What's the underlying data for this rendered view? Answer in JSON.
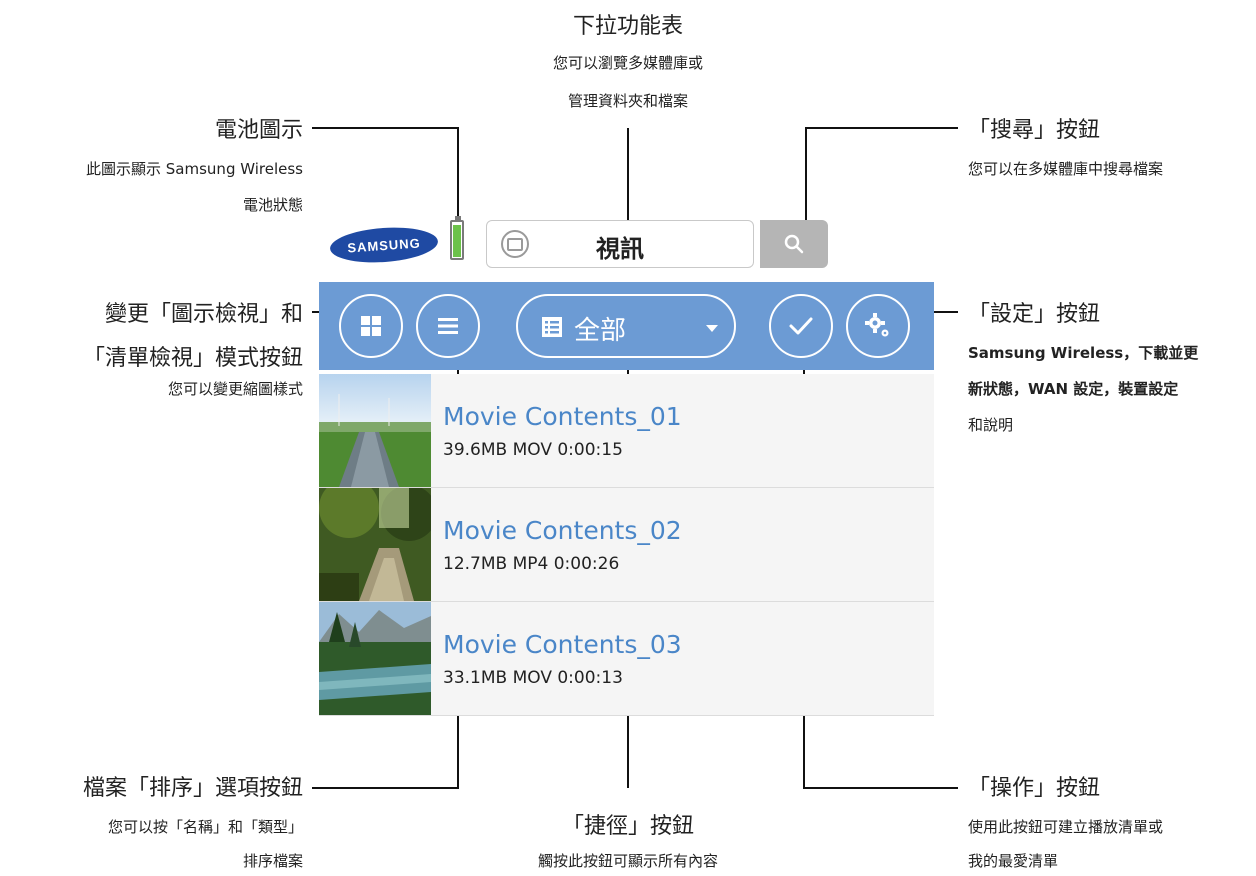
{
  "annotations": {
    "dropdown": {
      "title": "下拉功能表",
      "desc1": "您可以瀏覽多媒體庫或",
      "desc2": "管理資料夾和檔案"
    },
    "battery": {
      "title": "電池圖示",
      "desc1": "此圖示顯示 Samsung Wireless",
      "desc2": "電池狀態"
    },
    "search": {
      "title": "「搜尋」按鈕",
      "desc1": "您可以在多媒體庫中搜尋檔案"
    },
    "view_mode": {
      "title1": "變更「圖示檢視」和",
      "title2": "「清單檢視」模式按鈕",
      "desc1": "您可以變更縮圖樣式"
    },
    "settings": {
      "title": "「設定」按鈕",
      "desc1": "Samsung Wireless，下載並更",
      "desc2": "新狀態，WAN 設定，裝置設定",
      "desc3": "和說明"
    },
    "sort": {
      "title": "檔案「排序」選項按鈕",
      "desc1": "您可以按「名稱」和「類型」",
      "desc2": "排序檔案"
    },
    "shortcut": {
      "title": "「捷徑」按鈕",
      "desc1": "觸按此按鈕可顯示所有內容"
    },
    "action": {
      "title": "「操作」按鈕",
      "desc1": "使用此按鈕可建立播放清單或",
      "desc2": "我的最愛清單"
    }
  },
  "app": {
    "logo_text": "SAMSUNG",
    "dropdown_label": "視訊",
    "shortcut_label": "全部",
    "colors": {
      "toolbar": "#6c9bd4",
      "title_text": "#4a86c8",
      "battery": "#6cc24a"
    }
  },
  "files": [
    {
      "name": "Movie Contents_01",
      "meta": "39.6MB  MOV  0:00:15"
    },
    {
      "name": "Movie Contents_02",
      "meta": "12.7MB  MP4  0:00:26"
    },
    {
      "name": "Movie Contents_03",
      "meta": "33.1MB  MOV  0:00:13"
    }
  ],
  "icons": [
    "battery-icon",
    "video-camera-icon",
    "search-icon",
    "grid-view-icon",
    "list-view-icon",
    "list-icon",
    "checkmark-icon",
    "settings-gear-icon"
  ]
}
